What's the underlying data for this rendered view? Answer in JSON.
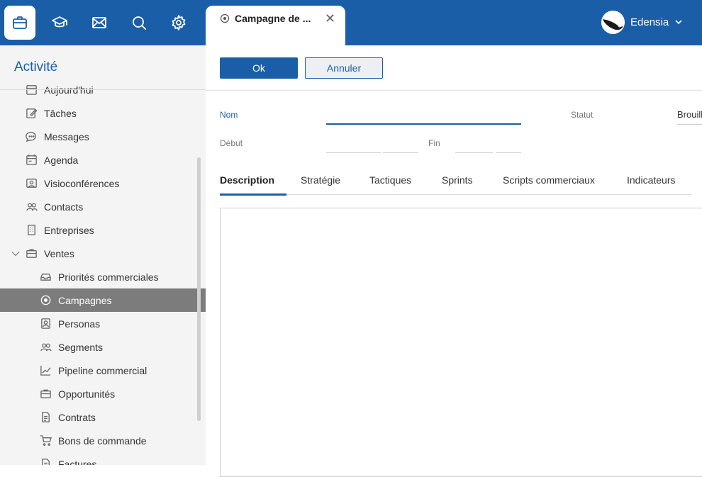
{
  "topbar": {
    "icons": [
      "briefcase-icon",
      "graduation-cap-icon",
      "mail-icon",
      "search-icon",
      "gear-icon"
    ],
    "tab_title": "Campagne de ...",
    "tab_close": "✕",
    "user_name": "Edensia"
  },
  "sidebar": {
    "title": "Activité",
    "items": [
      {
        "label": "Aujourd'hui",
        "icon": "calendar-day-icon"
      },
      {
        "label": "Tâches",
        "icon": "edit-icon"
      },
      {
        "label": "Messages",
        "icon": "chat-icon"
      },
      {
        "label": "Agenda",
        "icon": "calendar-icon"
      },
      {
        "label": "Visioconférences",
        "icon": "video-contact-icon"
      },
      {
        "label": "Contacts",
        "icon": "contacts-icon"
      },
      {
        "label": "Entreprises",
        "icon": "building-icon"
      },
      {
        "label": "Ventes",
        "icon": "briefcase-icon"
      },
      {
        "label": "Priorités commerciales",
        "icon": "inbox-icon"
      },
      {
        "label": "Campagnes",
        "icon": "target-icon"
      },
      {
        "label": "Personas",
        "icon": "persona-icon"
      },
      {
        "label": "Segments",
        "icon": "segments-icon"
      },
      {
        "label": "Pipeline commercial",
        "icon": "chart-line-icon"
      },
      {
        "label": "Opportunités",
        "icon": "briefcase-icon"
      },
      {
        "label": "Contrats",
        "icon": "document-icon"
      },
      {
        "label": "Bons de commande",
        "icon": "cart-icon"
      },
      {
        "label": "Factures",
        "icon": "invoice-icon"
      }
    ]
  },
  "form": {
    "ok_label": "Ok",
    "cancel_label": "Annuler",
    "nom_label": "Nom",
    "nom_value": "",
    "statut_label": "Statut",
    "statut_value": "Brouillon",
    "debut_label": "Début",
    "fin_label": "Fin",
    "tabs": [
      "Description",
      "Stratégie",
      "Tactiques",
      "Sprints",
      "Scripts commerciaux",
      "Indicateurs"
    ],
    "active_tab": "Description"
  },
  "colors": {
    "primary": "#1a5ea8",
    "selected": "#7c7c7c",
    "sidebar_bg": "#f4f4f4"
  }
}
